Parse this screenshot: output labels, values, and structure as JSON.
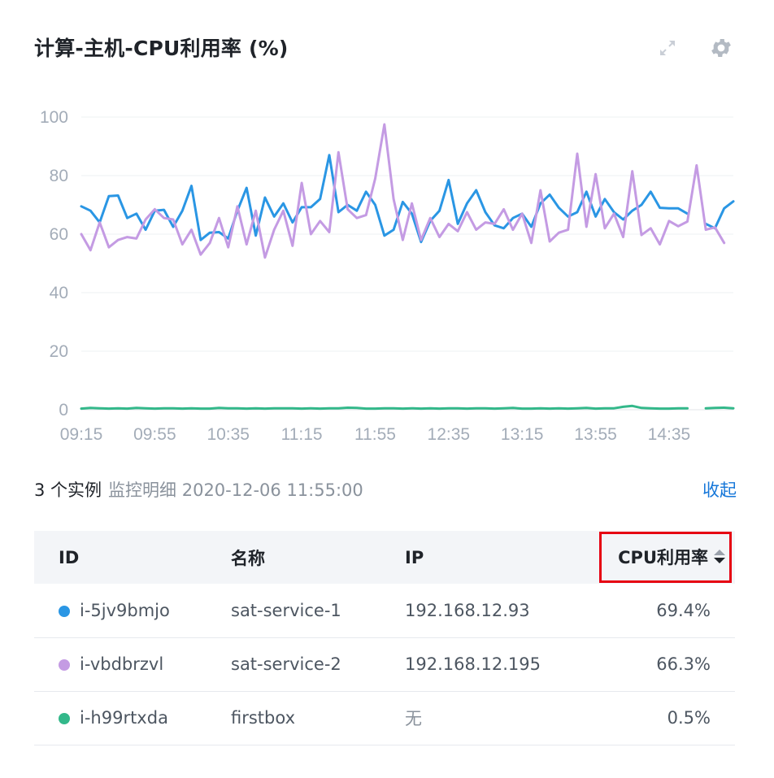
{
  "header": {
    "title": "计算-主机-CPU利用率 (%)"
  },
  "colors": {
    "series_blue": "#2a96e4",
    "series_purple": "#c49be3",
    "series_green": "#33b88a",
    "link": "#1677d9",
    "highlight_border": "#e60012"
  },
  "chart_data": {
    "type": "line",
    "ylim": [
      0,
      100
    ],
    "yticks": [
      0,
      20,
      40,
      60,
      80,
      100
    ],
    "xticks": [
      "09:15",
      "09:55",
      "10:35",
      "11:15",
      "11:55",
      "12:35",
      "13:15",
      "13:55",
      "14:35"
    ],
    "grid": true,
    "x_start": "09:15",
    "x_end": "15:10",
    "x_step_minutes": 5,
    "series": [
      {
        "name": "i-5jv9bmjo",
        "color": "#2a96e4",
        "values": [
          69.5,
          68,
          64,
          73,
          73.2,
          65.5,
          67,
          61.5,
          68,
          68.3,
          62.5,
          68,
          76.5,
          58,
          60.5,
          60.7,
          58.5,
          68,
          75.8,
          59.5,
          72.5,
          66,
          70.5,
          64,
          69.2,
          69.2,
          72,
          87,
          67.5,
          70,
          68,
          74.5,
          70,
          59.5,
          61.5,
          71,
          67,
          57.3,
          64.5,
          68,
          78.5,
          63.5,
          70.5,
          75,
          67.5,
          63,
          62,
          65.5,
          67,
          62.5,
          70.5,
          73.5,
          69,
          66,
          67.5,
          74.5,
          66,
          72,
          67.5,
          65,
          68,
          70,
          74.5,
          69,
          68.8,
          68.8,
          67,
          null,
          63.5,
          62,
          68.8,
          71.2
        ]
      },
      {
        "name": "i-vbdbrzvl",
        "color": "#c49be3",
        "values": [
          60,
          54.5,
          64,
          55.5,
          58,
          59,
          58.5,
          65,
          68.5,
          65.5,
          65,
          56.5,
          61.5,
          53,
          57,
          65.5,
          55.5,
          69.5,
          56.5,
          68,
          52,
          61.5,
          68,
          56,
          77.5,
          60,
          64.5,
          60.7,
          88,
          68.5,
          65.5,
          66.5,
          79,
          97.5,
          72,
          58,
          70.5,
          58,
          65.5,
          59,
          63.5,
          61,
          67.5,
          61.5,
          64,
          63.5,
          68.5,
          61.5,
          67,
          57,
          75,
          57.5,
          60.5,
          61.5,
          87.5,
          62.5,
          80.5,
          62,
          67,
          59,
          81.5,
          59.7,
          62,
          56.5,
          64.5,
          62.7,
          64.3,
          83.5,
          61.5,
          62.3,
          57
        ]
      },
      {
        "name": "i-h99rtxda",
        "color": "#33b88a",
        "values": [
          0.4,
          0.6,
          0.5,
          0.4,
          0.5,
          0.4,
          0.6,
          0.5,
          0.4,
          0.5,
          0.5,
          0.4,
          0.5,
          0.4,
          0.4,
          0.6,
          0.5,
          0.5,
          0.4,
          0.5,
          0.4,
          0.5,
          0.5,
          0.5,
          0.4,
          0.5,
          0.4,
          0.5,
          0.5,
          0.7,
          0.6,
          0.4,
          0.4,
          0.5,
          0.5,
          0.4,
          0.5,
          0.4,
          0.5,
          0.4,
          0.5,
          0.5,
          0.4,
          0.5,
          0.5,
          0.4,
          0.5,
          0.6,
          0.4,
          0.4,
          0.5,
          0.4,
          0.5,
          0.4,
          0.5,
          0.6,
          0.4,
          0.5,
          0.5,
          1.0,
          1.3,
          0.6,
          0.5,
          0.4,
          0.4,
          0.5,
          0.5,
          null,
          0.5,
          0.6,
          0.7,
          0.5
        ]
      }
    ]
  },
  "summary": {
    "count": "3 个实例",
    "detail": "监控明细 2020-12-06 11:55:00",
    "collapse_label": "收起"
  },
  "table": {
    "headers": {
      "id": "ID",
      "name": "名称",
      "ip": "IP",
      "cpu": "CPU利用率"
    },
    "rows": [
      {
        "id": "i-5jv9bmjo",
        "name": "sat-service-1",
        "ip": "192.168.12.93",
        "cpu": "69.4%",
        "color": "#2a96e4"
      },
      {
        "id": "i-vbdbrzvl",
        "name": "sat-service-2",
        "ip": "192.168.12.195",
        "cpu": "66.3%",
        "color": "#c49be3"
      },
      {
        "id": "i-h99rtxda",
        "name": "firstbox",
        "ip": "无",
        "cpu": "0.5%",
        "color": "#33b88a"
      }
    ]
  },
  "icons": {
    "fullscreen": "expand-arrows-icon",
    "settings": "gear-icon",
    "sort": "sort-caret-icon"
  }
}
